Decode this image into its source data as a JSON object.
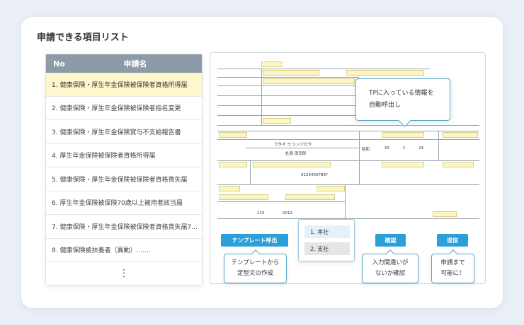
{
  "title": "申請できる項目リスト",
  "list": {
    "header_no": "No",
    "header_name": "申請名",
    "items": [
      "1.  健康保険・厚生年金保険被保険者資格所得届",
      "2.  健康保険・厚生年金保険被保険者指名変更",
      "3.  健康保険・厚生年金保険賞与不支給報告書",
      "4.  厚生年金保険被保険者資格所得届",
      "5.  健康保険・厚生年金保険被保険者資格喪失届",
      "6.  厚生年金保険被保険70歳以上被用者該当届",
      "7.  健康保険・厚生年金保険被保険者資格喪失届7...",
      "8.  健康保険被扶養者（異動）......."
    ],
    "more": "⋮"
  },
  "form": {
    "name_kana": "ラタオ ヨ シンジロウ",
    "name": "社員 田司郎",
    "number": "0123456789?",
    "date_parts": [
      "昭和",
      "55",
      "1",
      "24"
    ],
    "zip": "115",
    "zip2": "0012"
  },
  "tooltip": {
    "line1": "TPに入っている情報を",
    "line2": "自動呼出し"
  },
  "buttons": {
    "template": "テンプレート呼出",
    "confirm": "確認",
    "send": "送信"
  },
  "template_options": [
    "1. 本社",
    "2. 支社"
  ],
  "callouts": {
    "template": [
      "テンプレートから",
      "定型文の作成"
    ],
    "confirm": [
      "入力間違いが",
      "ないか確認"
    ],
    "send": [
      "申請まで",
      "可能に！"
    ]
  },
  "colors": {
    "accent": "#2a9fd8",
    "highlight": "#fff6cc",
    "header": "#8d9aa8"
  }
}
